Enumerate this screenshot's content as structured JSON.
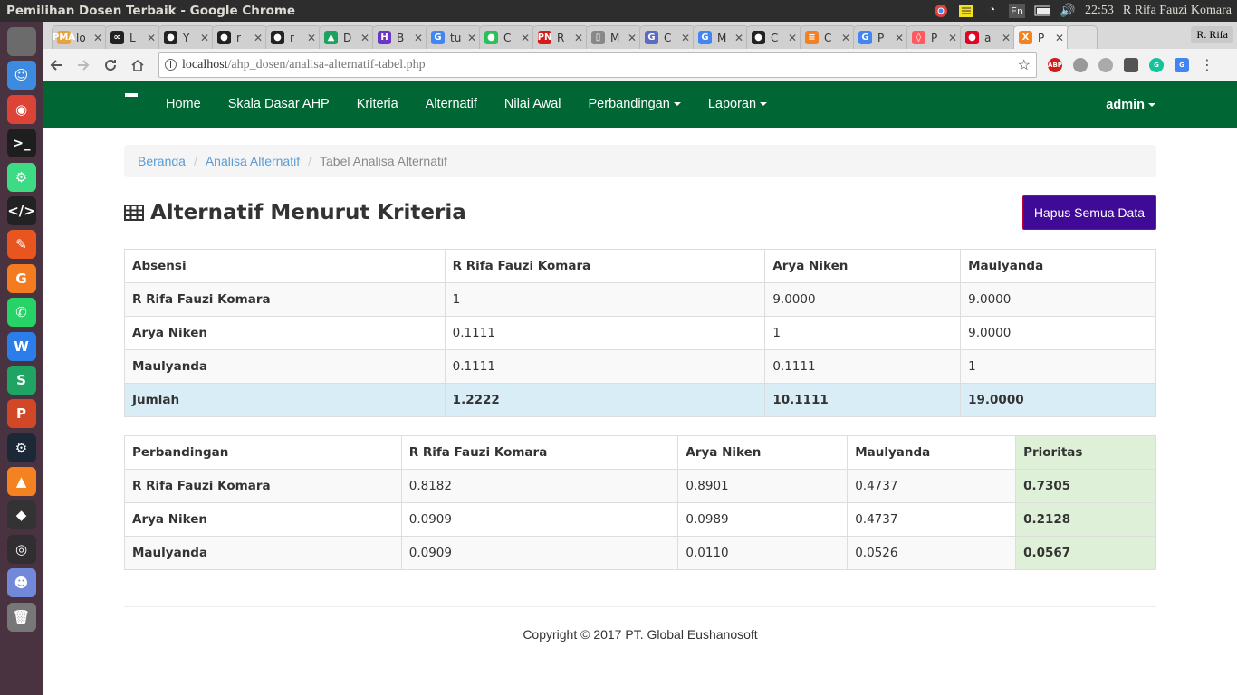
{
  "os": {
    "window_title": "Pemilihan Dosen Terbaik - Google Chrome",
    "tray": {
      "keyboard": "En",
      "time": "22:53",
      "user": "R Rifa Fauzi Komara"
    }
  },
  "browser": {
    "profile": "R. Rifa",
    "url_host": "localhost",
    "url_path": "/ahp_dosen/analisa-alternatif-tabel.php",
    "tabs": [
      {
        "label": "lo",
        "favicon_color": "#e8a33d",
        "favicon_text": "PMA"
      },
      {
        "label": "L",
        "favicon_color": "#222222",
        "favicon_text": "∞"
      },
      {
        "label": "Y",
        "favicon_color": "#222222",
        "favicon_text": "●"
      },
      {
        "label": "r",
        "favicon_color": "#222222",
        "favicon_text": "●"
      },
      {
        "label": "r",
        "favicon_color": "#222222",
        "favicon_text": "●"
      },
      {
        "label": "D",
        "favicon_color": "#1aa260",
        "favicon_text": "▲"
      },
      {
        "label": "B",
        "favicon_color": "#6b36c7",
        "favicon_text": "H"
      },
      {
        "label": "tu",
        "favicon_color": "#4285f4",
        "favicon_text": "G"
      },
      {
        "label": "C",
        "favicon_color": "#2bbf5a",
        "favicon_text": "●"
      },
      {
        "label": "R",
        "favicon_color": "#d11c1c",
        "favicon_text": "PN"
      },
      {
        "label": "M",
        "favicon_color": "#888888",
        "favicon_text": "▯"
      },
      {
        "label": "C",
        "favicon_color": "#5c6bc0",
        "favicon_text": "G"
      },
      {
        "label": "M",
        "favicon_color": "#4285f4",
        "favicon_text": "G"
      },
      {
        "label": "C",
        "favicon_color": "#222222",
        "favicon_text": "●"
      },
      {
        "label": "C",
        "favicon_color": "#f48024",
        "favicon_text": "≡"
      },
      {
        "label": "P",
        "favicon_color": "#4285f4",
        "favicon_text": "G"
      },
      {
        "label": "P",
        "favicon_color": "#ff5a5f",
        "favicon_text": "◊"
      },
      {
        "label": "a",
        "favicon_color": "#e60023",
        "favicon_text": "●"
      },
      {
        "label": "P",
        "favicon_color": "#f58220",
        "favicon_text": "X"
      }
    ],
    "active_tab_index": 18
  },
  "launcher": [
    {
      "name": "apple-icon",
      "color": "#6b6b6b",
      "glyph": ""
    },
    {
      "name": "finder-icon",
      "color": "#3d8be0",
      "glyph": "☺"
    },
    {
      "name": "chrome-icon",
      "color": "#db4437",
      "glyph": "◉"
    },
    {
      "name": "terminal-icon",
      "color": "#1e1e1e",
      "glyph": ">_"
    },
    {
      "name": "android-icon",
      "color": "#3ddc84",
      "glyph": "⚙"
    },
    {
      "name": "code-editor-icon",
      "color": "#222222",
      "glyph": "</>"
    },
    {
      "name": "pen-icon",
      "color": "#e8551f",
      "glyph": "✎"
    },
    {
      "name": "pdf-icon",
      "color": "#f47b20",
      "glyph": "G"
    },
    {
      "name": "whatsapp-icon",
      "color": "#25d366",
      "glyph": "✆"
    },
    {
      "name": "writer-icon",
      "color": "#2b7de9",
      "glyph": "W"
    },
    {
      "name": "spreadsheet-icon",
      "color": "#1fa463",
      "glyph": "S"
    },
    {
      "name": "presentation-icon",
      "color": "#d24726",
      "glyph": "P"
    },
    {
      "name": "steam-icon",
      "color": "#1b2838",
      "glyph": "⚙"
    },
    {
      "name": "vlc-icon",
      "color": "#f58220",
      "glyph": "▲"
    },
    {
      "name": "inkscape-icon",
      "color": "#333333",
      "glyph": "◆"
    },
    {
      "name": "obs-icon",
      "color": "#302e31",
      "glyph": "◎"
    },
    {
      "name": "discord-icon",
      "color": "#7289da",
      "glyph": "☻"
    },
    {
      "name": "trash-icon",
      "color": "#777777",
      "glyph": "🗑"
    }
  ],
  "nav": {
    "items": [
      "Home",
      "Skala Dasar AHP",
      "Kriteria",
      "Alternatif",
      "Nilai Awal"
    ],
    "dropdowns": [
      "Perbandingan",
      "Laporan"
    ],
    "user": "admin"
  },
  "breadcrumb": {
    "home": "Beranda",
    "parent": "Analisa Alternatif",
    "current": "Tabel Analisa Alternatif"
  },
  "page": {
    "title": "Alternatif Menurut Kriteria",
    "delete_button": "Hapus Semua Data"
  },
  "matrix": {
    "corner": "Absensi",
    "columns": [
      "R Rifa Fauzi Komara",
      "Arya Niken",
      "Maulyanda"
    ],
    "rows": [
      {
        "label": "R Rifa Fauzi Komara",
        "values": [
          "1",
          "9.0000",
          "9.0000"
        ]
      },
      {
        "label": "Arya Niken",
        "values": [
          "0.1111",
          "1",
          "9.0000"
        ]
      },
      {
        "label": "Maulyanda",
        "values": [
          "0.1111",
          "0.1111",
          "1"
        ]
      }
    ],
    "total": {
      "label": "Jumlah",
      "values": [
        "1.2222",
        "10.1111",
        "19.0000"
      ]
    }
  },
  "normalized": {
    "corner": "Perbandingan",
    "columns": [
      "R Rifa Fauzi Komara",
      "Arya Niken",
      "Maulyanda"
    ],
    "priority_header": "Prioritas",
    "rows": [
      {
        "label": "R Rifa Fauzi Komara",
        "values": [
          "0.8182",
          "0.8901",
          "0.4737"
        ],
        "priority": "0.7305"
      },
      {
        "label": "Arya Niken",
        "values": [
          "0.0909",
          "0.0989",
          "0.4737"
        ],
        "priority": "0.2128"
      },
      {
        "label": "Maulyanda",
        "values": [
          "0.0909",
          "0.0110",
          "0.0526"
        ],
        "priority": "0.0567"
      }
    ]
  },
  "footer": "Copyright © 2017 PT. Global Eushanosoft"
}
